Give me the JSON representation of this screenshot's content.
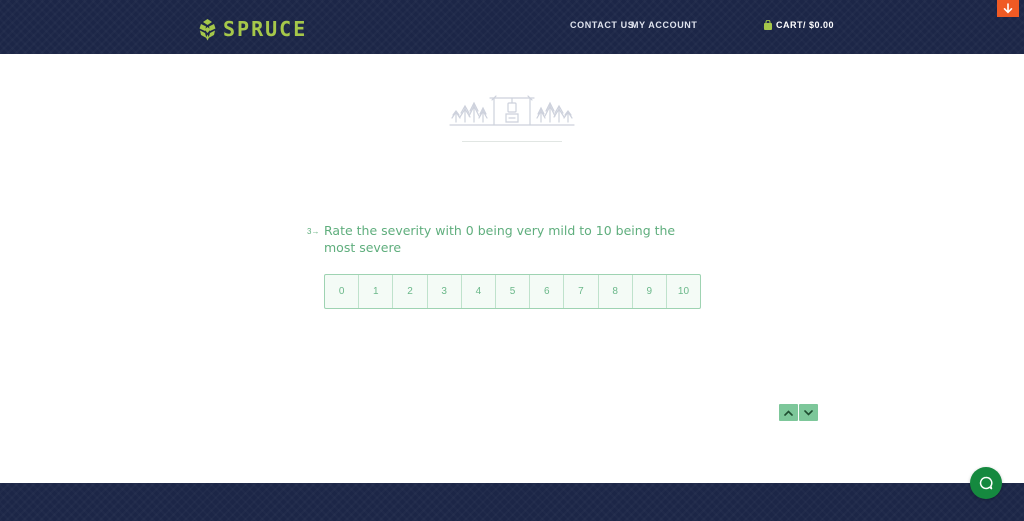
{
  "header": {
    "brand": "SPRUCE",
    "nav": {
      "contact": "CONTACT US",
      "account": "MY ACCOUNT"
    },
    "cart_label": "CART/ $0.00"
  },
  "question": {
    "number": "3→",
    "text": "Rate the severity with 0 being very mild to 10 being the most severe",
    "options": [
      "0",
      "1",
      "2",
      "3",
      "4",
      "5",
      "6",
      "7",
      "8",
      "9",
      "10"
    ]
  },
  "icons": {
    "logo": "pinecone-logo-icon",
    "cart": "shopping-bag-icon",
    "scroll": "arrow-down-icon",
    "pager_up": "chevron-up-icon",
    "pager_down": "chevron-down-icon",
    "chat": "chat-bubble-icon"
  },
  "colors": {
    "header_bg": "#1c2647",
    "brand_green": "#a6c84a",
    "accent_green": "#5fae7d",
    "orange": "#f05a24",
    "chat_green": "#15893f"
  }
}
